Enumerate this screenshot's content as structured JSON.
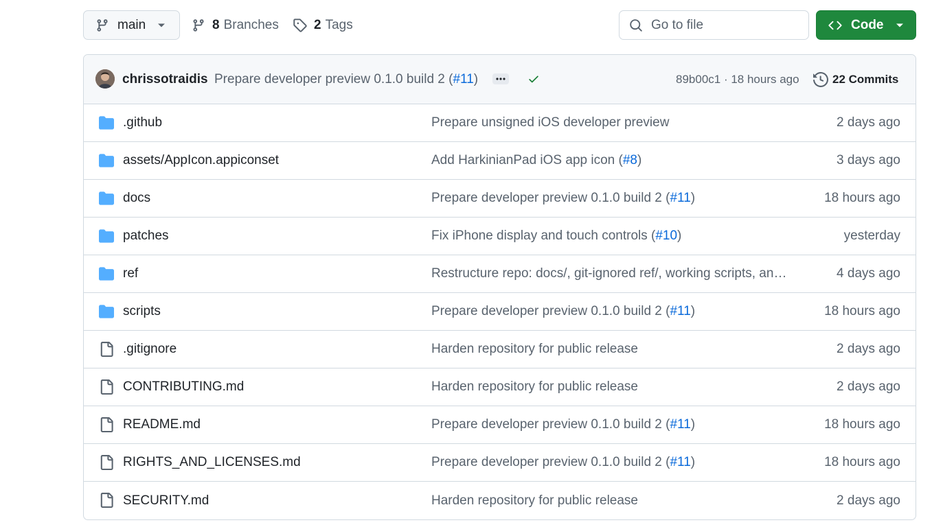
{
  "toolbar": {
    "branch_label": "main",
    "branches_count": "8",
    "branches_label": "Branches",
    "tags_count": "2",
    "tags_label": "Tags",
    "goto_placeholder": "Go to file",
    "code_label": "Code"
  },
  "colors": {
    "folder": "#54aeff",
    "file": "#59636e",
    "link": "#0969da",
    "code_button": "#1f883d",
    "check": "#1a7f37"
  },
  "commit": {
    "author": "chrissotraidis",
    "message_prefix": "Prepare developer preview 0.1.0 build 2 (",
    "pr_link": "#11",
    "message_suffix": ")",
    "hash_time": "89b00c1 · 18 hours ago",
    "commits_label": "22 Commits"
  },
  "files": [
    {
      "type": "folder",
      "name": ".github",
      "message": "Prepare unsigned iOS developer preview",
      "pr": "",
      "pr_suffix": "",
      "time": "2 days ago"
    },
    {
      "type": "folder",
      "name": "assets/AppIcon.appiconset",
      "message": "Add HarkinianPad iOS app icon (",
      "pr": "#8",
      "pr_suffix": ")",
      "time": "3 days ago"
    },
    {
      "type": "folder",
      "name": "docs",
      "message": "Prepare developer preview 0.1.0 build 2 (",
      "pr": "#11",
      "pr_suffix": ")",
      "time": "18 hours ago"
    },
    {
      "type": "folder",
      "name": "patches",
      "message": "Fix iPhone display and touch controls (",
      "pr": "#10",
      "pr_suffix": ")",
      "time": "yesterday"
    },
    {
      "type": "folder",
      "name": "ref",
      "message": "Restructure repo: docs/, git-ignored ref/, working scripts, and more",
      "pr": "",
      "pr_suffix": "",
      "time": "4 days ago"
    },
    {
      "type": "folder",
      "name": "scripts",
      "message": "Prepare developer preview 0.1.0 build 2 (",
      "pr": "#11",
      "pr_suffix": ")",
      "time": "18 hours ago"
    },
    {
      "type": "file",
      "name": ".gitignore",
      "message": "Harden repository for public release",
      "pr": "",
      "pr_suffix": "",
      "time": "2 days ago"
    },
    {
      "type": "file",
      "name": "CONTRIBUTING.md",
      "message": "Harden repository for public release",
      "pr": "",
      "pr_suffix": "",
      "time": "2 days ago"
    },
    {
      "type": "file",
      "name": "README.md",
      "message": "Prepare developer preview 0.1.0 build 2 (",
      "pr": "#11",
      "pr_suffix": ")",
      "time": "18 hours ago"
    },
    {
      "type": "file",
      "name": "RIGHTS_AND_LICENSES.md",
      "message": "Prepare developer preview 0.1.0 build 2 (",
      "pr": "#11",
      "pr_suffix": ")",
      "time": "18 hours ago"
    },
    {
      "type": "file",
      "name": "SECURITY.md",
      "message": "Harden repository for public release",
      "pr": "",
      "pr_suffix": "",
      "time": "2 days ago"
    }
  ]
}
